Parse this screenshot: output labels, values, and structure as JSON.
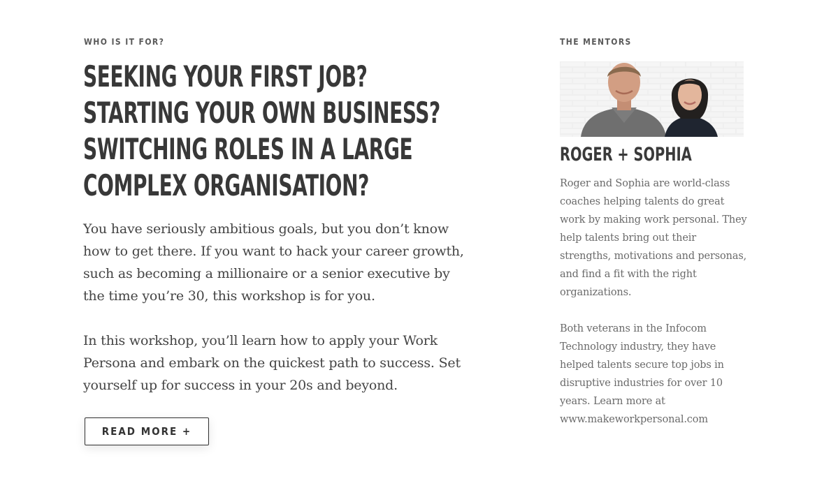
{
  "who": {
    "eyebrow": "WHO IS IT FOR?",
    "headline_lines": [
      "SEEKING YOUR FIRST JOB?",
      "STARTING YOUR OWN BUSINESS?",
      "SWITCHING ROLES IN A LARGE",
      "COMPLEX ORGANISATION?"
    ],
    "paragraph_1": "You have seriously ambitious goals, but you don’t know how to get there. If you want to hack your career growth, such as becoming a millionaire or a senior executive by the time you’re 30, this workshop is for you.",
    "paragraph_2": "In this workshop, you’ll learn how to apply your Work Persona and embark on the quickest path to success. Set yourself up for success in your 20s and beyond.",
    "read_more_label": "READ MORE +"
  },
  "mentors": {
    "eyebrow": "THE MENTORS",
    "name": "ROGER + SOPHIA",
    "paragraph_1": "Roger and Sophia are world-class coaches helping talents do great work by making work personal. They help talents bring out their strengths, motivations and personas, and find a fit with the right organizations.",
    "paragraph_2": "Both veterans in the Infocom Technology industry, they have helped talents secure top jobs in disruptive industries for over 10 years. Learn more at www.makeworkpersonal.com"
  },
  "colors": {
    "heading": "#383838",
    "body": "#444444",
    "muted": "#6a6a6a",
    "button_border": "#2f2f2f"
  }
}
